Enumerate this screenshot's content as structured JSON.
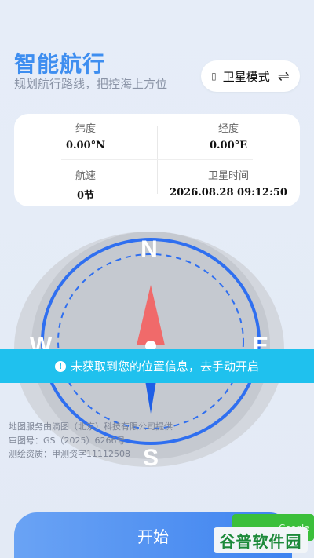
{
  "header": {
    "title": "智能航行",
    "subtitle": "规划航行路线，把控海上方位",
    "mode_button": {
      "glyph": "▯",
      "label": "卫星模式",
      "swap_icon": "⇌"
    }
  },
  "info": {
    "latitude_label": "纬度",
    "latitude_value": "0.00°N",
    "longitude_label": "经度",
    "longitude_value": "0.00°E",
    "speed_label": "航速",
    "speed_value": "0节",
    "sat_time_label": "卫星时间",
    "sat_time_value": "2026.08.28 09:12:50"
  },
  "compass": {
    "north": "N",
    "south": "S",
    "west": "W",
    "east": "E",
    "colors": {
      "ring": "#2f6ff0",
      "north_needle": "#f06a6a",
      "south_needle": "#1f5fe6",
      "face": "#c4c8cf"
    }
  },
  "toast": {
    "icon": "!",
    "message": "未获取到您的位置信息，去手动开启"
  },
  "map_credit": {
    "line1": "地图服务由滴图（北京）科技有限公司提供",
    "line2": "审图号：GS（2025）6266号",
    "line3": "测绘资质：甲测资字11112508"
  },
  "footer": {
    "start_label": "开始",
    "badge_text": "Google",
    "watermark": "谷普软件园"
  }
}
